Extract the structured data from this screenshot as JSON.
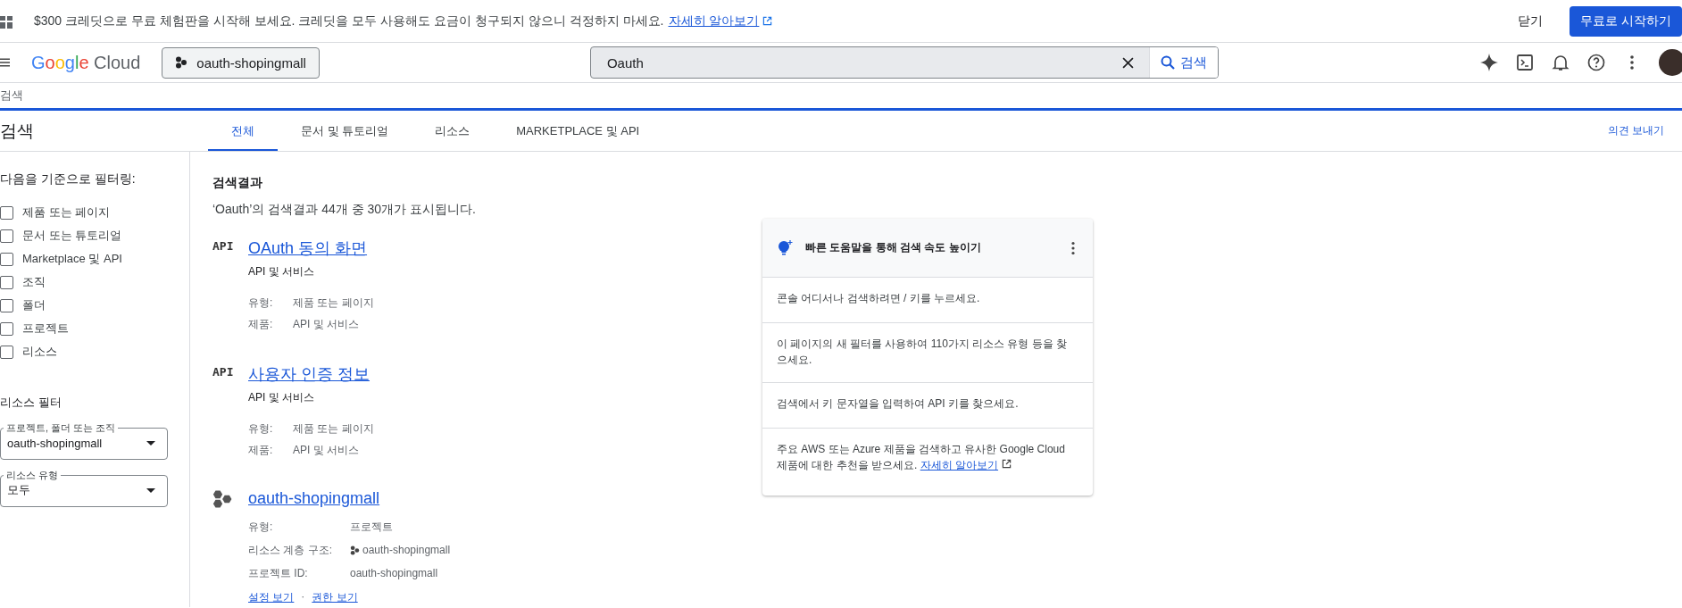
{
  "banner": {
    "text": "$300 크레딧으로 무료 체험판을 시작해 보세요. 크레딧을 모두 사용해도 요금이 청구되지 않으니 걱정하지 마세요.",
    "link": "자세히 알아보기",
    "dismiss": "닫기",
    "cta": "무료로 시작하기"
  },
  "header": {
    "logo_google": "Google",
    "logo_cloud": "Cloud",
    "project": "oauth-shopingmall",
    "search": {
      "value": "Oauth",
      "button": "검색"
    }
  },
  "breadcrumb": "검색",
  "page": {
    "title": "검색",
    "feedback": "의견 보내기"
  },
  "tabs": [
    {
      "label": "전체",
      "selected": true
    },
    {
      "label": "문서 및 튜토리얼",
      "selected": false
    },
    {
      "label": "리소스",
      "selected": false
    },
    {
      "label": "MARKETPLACE 및 API",
      "selected": false
    }
  ],
  "filters": {
    "heading": "다음을 기준으로 필터링:",
    "options": [
      {
        "label": "제품 또는 페이지",
        "checked": false
      },
      {
        "label": "문서 또는 튜토리얼",
        "checked": false
      },
      {
        "label": "Marketplace 및 API",
        "checked": false
      },
      {
        "label": "조직",
        "checked": false
      },
      {
        "label": "폴더",
        "checked": false
      },
      {
        "label": "프로젝트",
        "checked": false
      },
      {
        "label": "리소스",
        "checked": false
      }
    ],
    "resource_heading": "리소스 필터",
    "selects": [
      {
        "label": "프로젝트, 폴더 또는 조직",
        "value": "oauth-shopingmall"
      },
      {
        "label": "리소스 유형",
        "value": "모두"
      }
    ]
  },
  "results": {
    "heading": "검색결과",
    "summary": "‘Oauth’의 검색결과 44개 중 30개가 표시됩니다.",
    "items": [
      {
        "kind": "api",
        "badge": "API",
        "title": "OAuth 동의 화면",
        "subtitle": "API 및 서비스",
        "details": [
          {
            "label": "유형:",
            "value": "제품 또는 페이지",
            "kind": "text"
          },
          {
            "label": "제품:",
            "value": "API 및 서비스",
            "kind": "text"
          }
        ]
      },
      {
        "kind": "api",
        "badge": "API",
        "title": "사용자 인증 정보",
        "subtitle": "API 및 서비스",
        "details": [
          {
            "label": "유형:",
            "value": "제품 또는 페이지",
            "kind": "text"
          },
          {
            "label": "제품:",
            "value": "API 및 서비스",
            "kind": "text"
          }
        ]
      },
      {
        "kind": "project",
        "title": "oauth-shopingmall",
        "details": [
          {
            "label": "유형:",
            "value": "프로젝트",
            "kind": "text"
          },
          {
            "label": "리소스 계층 구조:",
            "value": "oauth-shopingmall",
            "kind": "project"
          },
          {
            "label": "프로젝트 ID:",
            "value": "oauth-shopingmall",
            "kind": "text"
          }
        ],
        "links": [
          "설정 보기",
          "권한 보기"
        ],
        "separator": "·"
      }
    ]
  },
  "tips": {
    "title": "빠른 도움말을 통해 검색 속도 높이기",
    "items": [
      {
        "text": "콘솔 어디서나 검색하려면 / 키를 누르세요."
      },
      {
        "text": "이 페이지의 새 필터를 사용하여 110가지 리소스 유형 등을 찾으세요."
      },
      {
        "text": "검색에서 키 문자열을 입력하여 API 키를 찾으세요."
      },
      {
        "text": "주요 AWS 또는 Azure 제품을 검색하고 유사한 Google Cloud 제품에 대한 추천을 받으세요.",
        "link": "자세히 알아보기"
      }
    ]
  }
}
